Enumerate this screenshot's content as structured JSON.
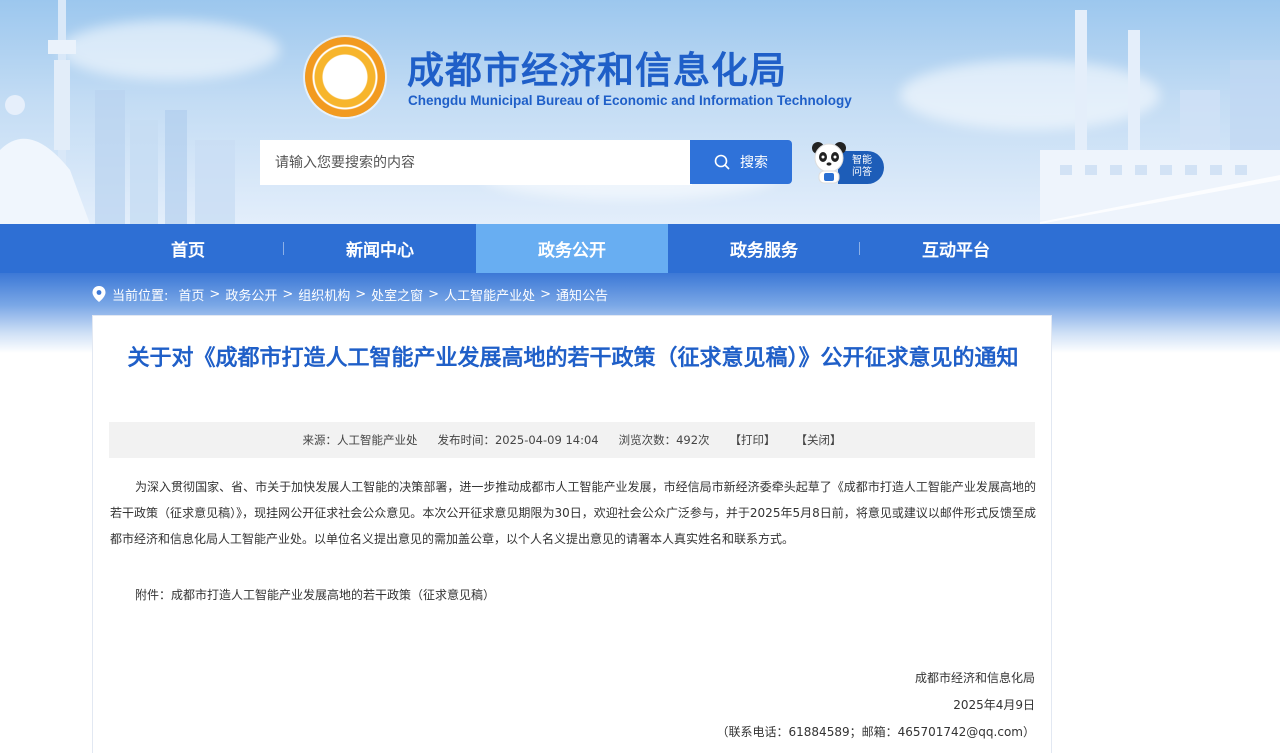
{
  "header": {
    "title": "成都市经济和信息化局",
    "subtitle": "Chengdu Municipal Bureau of Economic and Information Technology",
    "search_placeholder": "请输入您要搜索的内容",
    "search_button": "搜索",
    "qa_line1": "智能",
    "qa_line2": "问答"
  },
  "nav": {
    "items": [
      {
        "label": "首页"
      },
      {
        "label": "新闻中心"
      },
      {
        "label": "政务公开"
      },
      {
        "label": "政务服务"
      },
      {
        "label": "互动平台"
      }
    ],
    "active_index": 2
  },
  "breadcrumb": {
    "prefix": "当前位置:",
    "items": [
      "首页",
      "政务公开",
      "组织机构",
      "处室之窗",
      "人工智能产业处",
      "通知公告"
    ],
    "separator": ">"
  },
  "article": {
    "title": "关于对《成都市打造人工智能产业发展高地的若干政策（征求意见稿）》公开征求意见的通知",
    "meta": {
      "source": "来源：人工智能产业处",
      "published": "发布时间：2025-04-09 14:04",
      "views": "浏览次数：492次",
      "print": "【打印】",
      "close": "【关闭】"
    },
    "body": "为深入贯彻国家、省、市关于加快发展人工智能的决策部署，进一步推动成都市人工智能产业发展，市经信局市新经济委牵头起草了《成都市打造人工智能产业发展高地的若干政策（征求意见稿）》，现挂网公开征求社会公众意见。本次公开征求意见期限为30日，欢迎社会公众广泛参与，并于2025年5月8日前，将意见或建议以邮件形式反馈至成都市经济和信息化局人工智能产业处。以单位名义提出意见的需加盖公章，以个人名义提出意见的请署本人真实姓名和联系方式。",
    "attachment": "附件：成都市打造人工智能产业发展高地的若干政策（征求意见稿）",
    "sign_org": "成都市经济和信息化局",
    "sign_date": "2025年4月9日",
    "contact": "（联系电话：61884589；邮箱：465701742@qq.com）"
  },
  "colors": {
    "brand_blue": "#1f5fc8",
    "nav_blue": "#2e6fd4",
    "nav_active": "#68aef2"
  }
}
